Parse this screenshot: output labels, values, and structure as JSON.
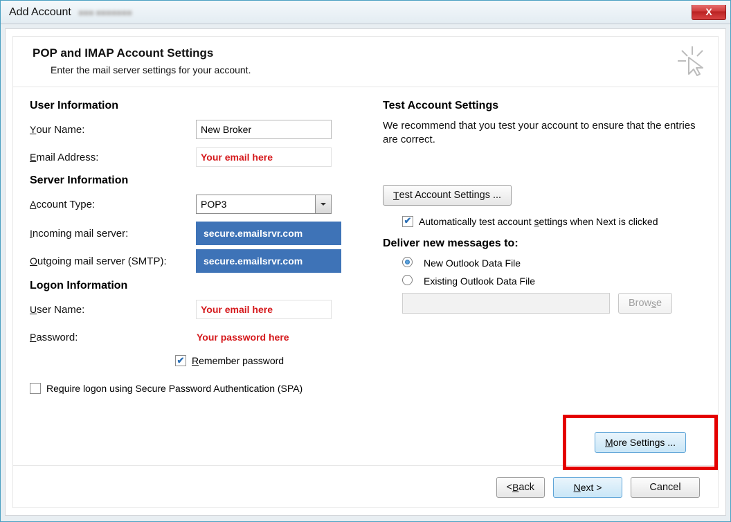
{
  "window": {
    "title": "Add Account"
  },
  "header": {
    "title": "POP and IMAP Account Settings",
    "subtitle": "Enter the mail server settings for your account."
  },
  "left": {
    "user_info_head": "User Information",
    "your_name_label": "Your Name:",
    "your_name_value": "New Broker",
    "email_label": "Email Address:",
    "email_value": "Your email here",
    "server_info_head": "Server Information",
    "account_type_label": "Account Type:",
    "account_type_value": "POP3",
    "incoming_label": "Incoming mail server:",
    "incoming_value": "secure.emailsrvr.com",
    "outgoing_label": "Outgoing mail server (SMTP):",
    "outgoing_value": "secure.emailsrvr.com",
    "logon_head": "Logon Information",
    "username_label": "User Name:",
    "username_value": "Your email here",
    "password_label": "Password:",
    "password_value": "Your password here",
    "remember_label": "Remember password",
    "spa_label": "Require logon using Secure Password Authentication (SPA)"
  },
  "right": {
    "test_head": "Test Account Settings",
    "test_desc": "We recommend that you test your account to ensure that the entries are correct.",
    "test_btn": "Test Account Settings ...",
    "auto_test_label": "Automatically test account settings when Next is clicked",
    "deliver_head": "Deliver new messages to:",
    "radio_new": "New Outlook Data File",
    "radio_existing": "Existing Outlook Data File",
    "browse_btn": "Browse",
    "more_btn": "More Settings ..."
  },
  "wizard": {
    "back": "< Back",
    "next": "Next >",
    "cancel": "Cancel"
  }
}
